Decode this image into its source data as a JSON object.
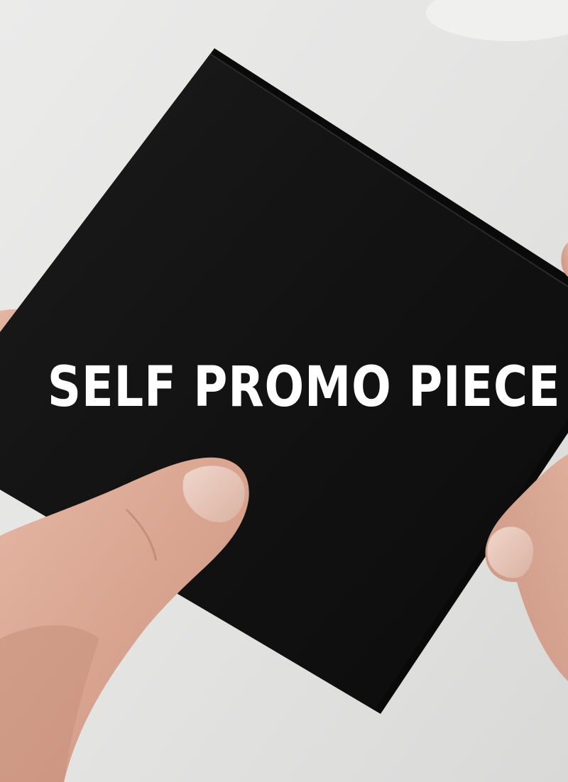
{
  "overlay": {
    "title": "SELF PROMO PIECE"
  },
  "colors": {
    "wall": "#e6e6e6",
    "card": "#141414",
    "skin": "#d9a894",
    "text": "#ffffff"
  }
}
